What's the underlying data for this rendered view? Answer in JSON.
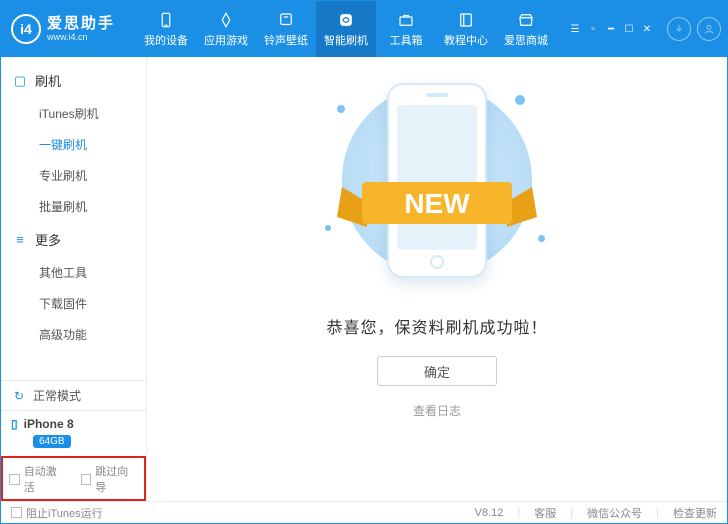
{
  "app": {
    "name_cn": "爱思助手",
    "url": "www.i4.cn",
    "logo_text": "i4"
  },
  "nav": [
    {
      "label": "我的设备",
      "icon": "phone-icon"
    },
    {
      "label": "应用游戏",
      "icon": "apps-icon"
    },
    {
      "label": "铃声壁纸",
      "icon": "music-icon"
    },
    {
      "label": "智能刷机",
      "icon": "flash-icon",
      "active": true
    },
    {
      "label": "工具箱",
      "icon": "toolbox-icon"
    },
    {
      "label": "教程中心",
      "icon": "book-icon"
    },
    {
      "label": "爱思商城",
      "icon": "store-icon"
    }
  ],
  "sidebar": {
    "groups": [
      {
        "title": "刷机",
        "items": [
          "iTunes刷机",
          "一键刷机",
          "专业刷机",
          "批量刷机"
        ],
        "active_index": 1
      },
      {
        "title": "更多",
        "items": [
          "其他工具",
          "下载固件",
          "高级功能"
        ],
        "active_index": -1
      }
    ],
    "status": {
      "label": "正常模式",
      "icon": "sync-icon"
    },
    "device": {
      "name": "iPhone 8",
      "storage": "64GB",
      "icon": "phone-small-icon"
    },
    "bottom": {
      "auto_activate": "自动激活",
      "skip_guide": "跳过向导"
    }
  },
  "main": {
    "ribbon_text": "NEW",
    "message": "恭喜您，保资料刷机成功啦！",
    "ok_label": "确定",
    "log_label": "查看日志"
  },
  "statusbar": {
    "block_itunes": "阻止iTunes运行",
    "version": "V8.12",
    "support": "客服",
    "wechat": "微信公众号",
    "update": "检查更新"
  }
}
